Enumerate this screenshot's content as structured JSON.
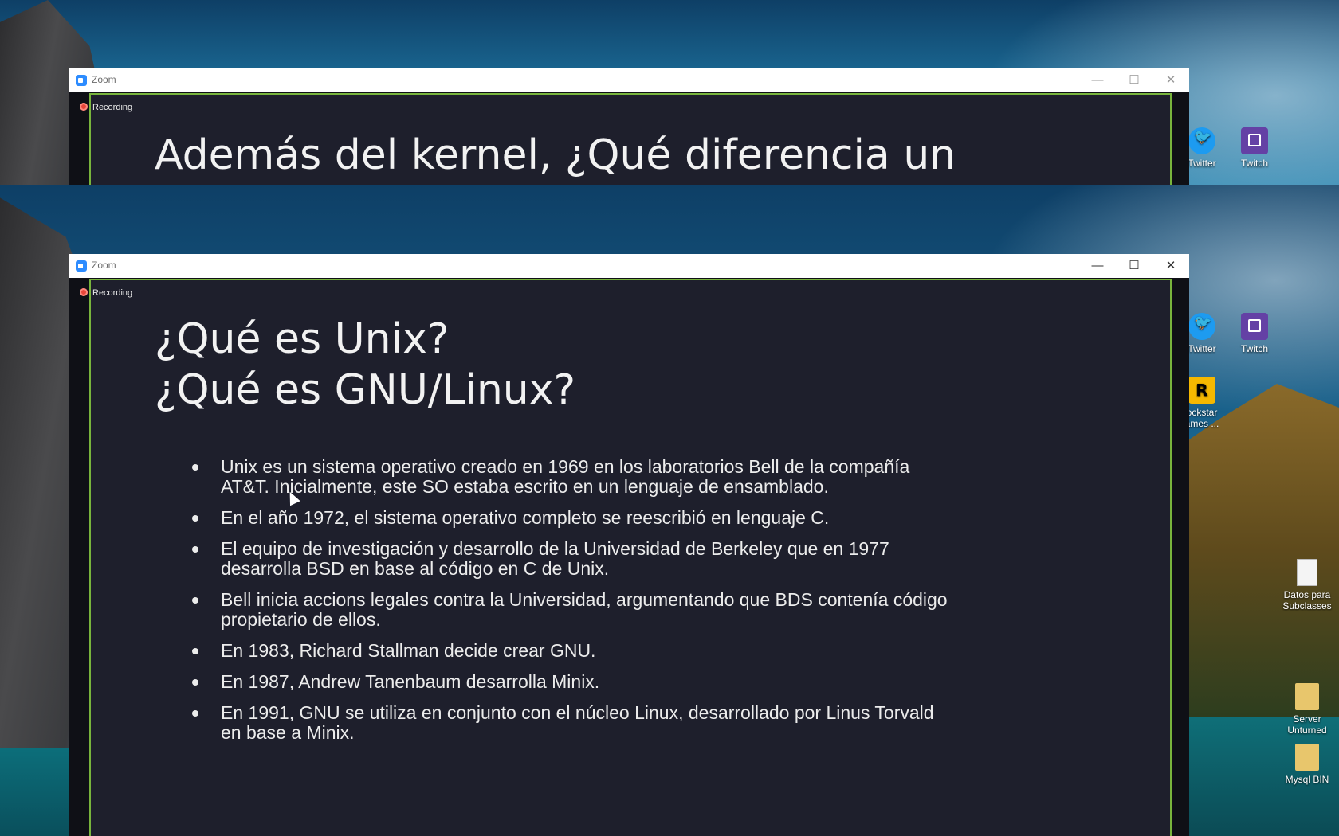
{
  "window_top": {
    "title": "Zoom",
    "recording_label": "Recording",
    "slide_title": "Además del kernel, ¿Qué diferencia un"
  },
  "window_bottom": {
    "title": "Zoom",
    "recording_label": "Recording",
    "slide_title_line1": "¿Qué es Unix?",
    "slide_title_line2": "¿Qué es GNU/Linux?",
    "bullets": [
      "Unix es un sistema operativo creado en 1969 en los laboratorios Bell de la compañía AT&T. Inicialmente, este SO estaba escrito en un lenguaje de ensamblado.",
      "En el año 1972, el sistema operativo completo se reescribió en lenguaje C.",
      "El equipo de investigación y desarrollo de la Universidad de Berkeley que en 1977 desarrolla BSD en base al código en C de Unix.",
      "Bell inicia accions legales contra la Universidad, argumentando que BDS contenía código propietario de ellos.",
      "En 1983, Richard Stallman decide crear GNU.",
      "En 1987, Andrew Tanenbaum desarrolla Minix.",
      "En 1991, GNU se utiliza en conjunto con el núcleo Linux, desarrollado por Linus Torvald en base a Minix."
    ]
  },
  "window_controls": {
    "minimize": "—",
    "maximize": "☐",
    "close": "✕"
  },
  "desktop_icons_top": [
    {
      "label": "Twitter",
      "icon": "twitter-icon"
    },
    {
      "label": "Twitch",
      "icon": "twitch-icon"
    }
  ],
  "desktop_icons_bottom": [
    {
      "label": "Twitter",
      "icon": "twitter-icon"
    },
    {
      "label": "Twitch",
      "icon": "twitch-icon"
    },
    {
      "label": "ockstar\names ...",
      "icon": "rockstar-games-icon"
    },
    {
      "label": "Datos para Subclasses",
      "icon": "document-icon"
    },
    {
      "label": "Server Unturned",
      "icon": "folder-icon"
    },
    {
      "label": "Mysql BIN",
      "icon": "folder-icon"
    }
  ],
  "colors": {
    "share_border": "#78b43c",
    "slide_bg": "#1e1f2c",
    "recording_dot": "#e8463a"
  }
}
